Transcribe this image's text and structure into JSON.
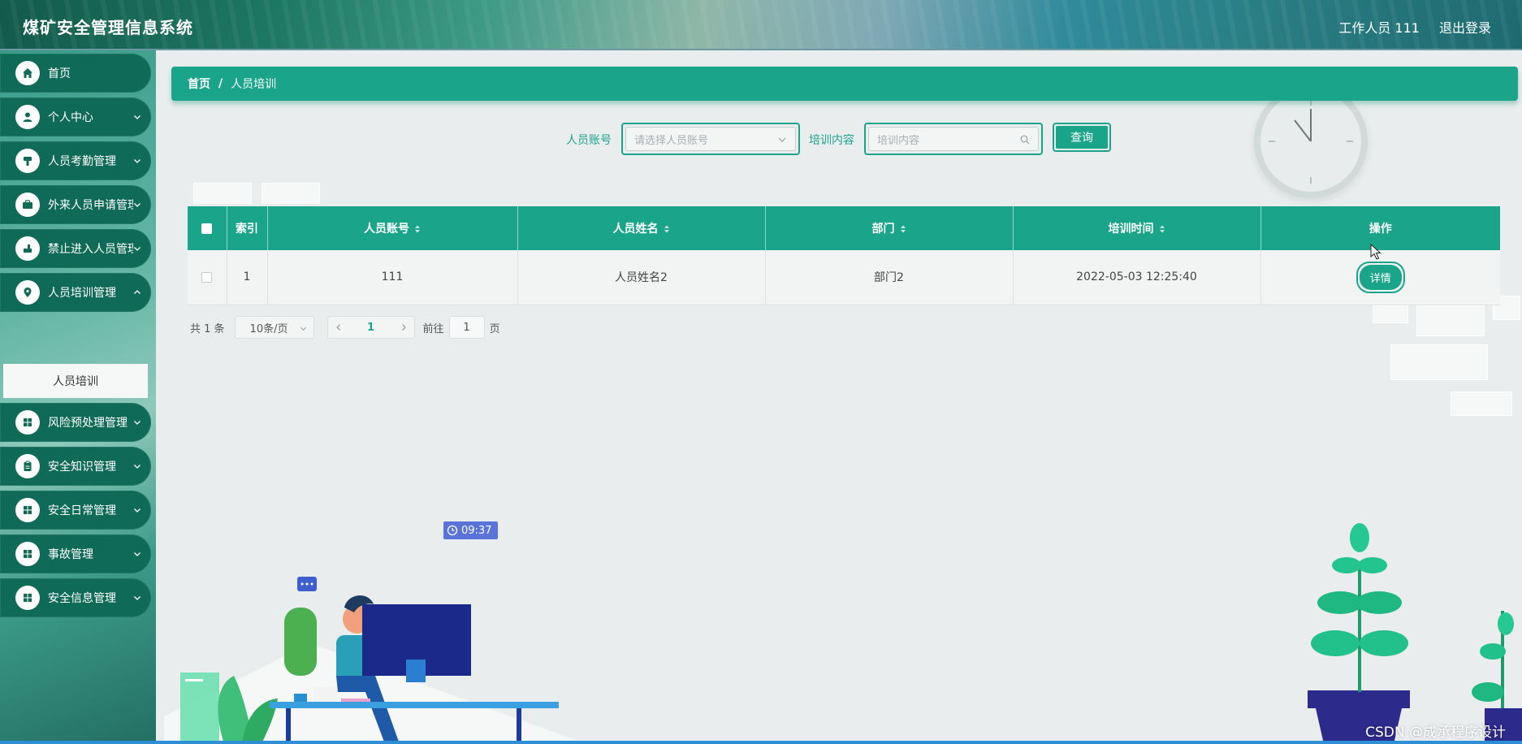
{
  "header": {
    "app_title": "煤矿安全管理信息系统",
    "user_label": "工作人员 111",
    "logout_label": "退出登录"
  },
  "sidebar": {
    "items": [
      {
        "label": "首页",
        "icon": "home-icon",
        "has_children": false
      },
      {
        "label": "个人中心",
        "icon": "user-icon",
        "has_children": true
      },
      {
        "label": "人员考勤管理",
        "icon": "attendance-icon",
        "has_children": true
      },
      {
        "label": "外来人员申请管理",
        "icon": "briefcase-icon",
        "has_children": true
      },
      {
        "label": "禁止进入人员管理",
        "icon": "no-entry-icon",
        "has_children": true
      },
      {
        "label": "人员培训管理",
        "icon": "location-icon",
        "has_children": true
      },
      {
        "label": "风险预处理管理",
        "icon": "grid-icon",
        "has_children": true
      },
      {
        "label": "安全知识管理",
        "icon": "clipboard-icon",
        "has_children": true
      },
      {
        "label": "安全日常管理",
        "icon": "grid-icon",
        "has_children": true
      },
      {
        "label": "事故管理",
        "icon": "grid-icon",
        "has_children": true
      },
      {
        "label": "安全信息管理",
        "icon": "grid-icon",
        "has_children": true
      }
    ],
    "active_sub_item": "人员培训"
  },
  "breadcrumb": {
    "home": "首页",
    "separator": "/",
    "current": "人员培训"
  },
  "filters": {
    "account_label": "人员账号",
    "account_placeholder": "请选择人员账号",
    "content_label": "培训内容",
    "content_placeholder": "培训内容",
    "query_button": "查询"
  },
  "table": {
    "columns": [
      "索引",
      "人员账号",
      "人员姓名",
      "部门",
      "培训时间",
      "操作"
    ],
    "rows": [
      {
        "index": "1",
        "account": "111",
        "name": "人员姓名2",
        "department": "部门2",
        "training_time": "2022-05-03 12:25:40",
        "action": "详情"
      }
    ]
  },
  "pagination": {
    "total": "共 1 条",
    "page_size": "10条/页",
    "current_page": "1",
    "jump_prefix": "前往",
    "jump_value": "1",
    "jump_suffix": "页"
  },
  "illustration": {
    "time_badge": "09:37"
  },
  "watermark": "CSDN @成承程序设计",
  "colors": {
    "primary": "#1aa58a",
    "sidebar_item": "#0f6b57",
    "page_bg": "#e9eded"
  }
}
